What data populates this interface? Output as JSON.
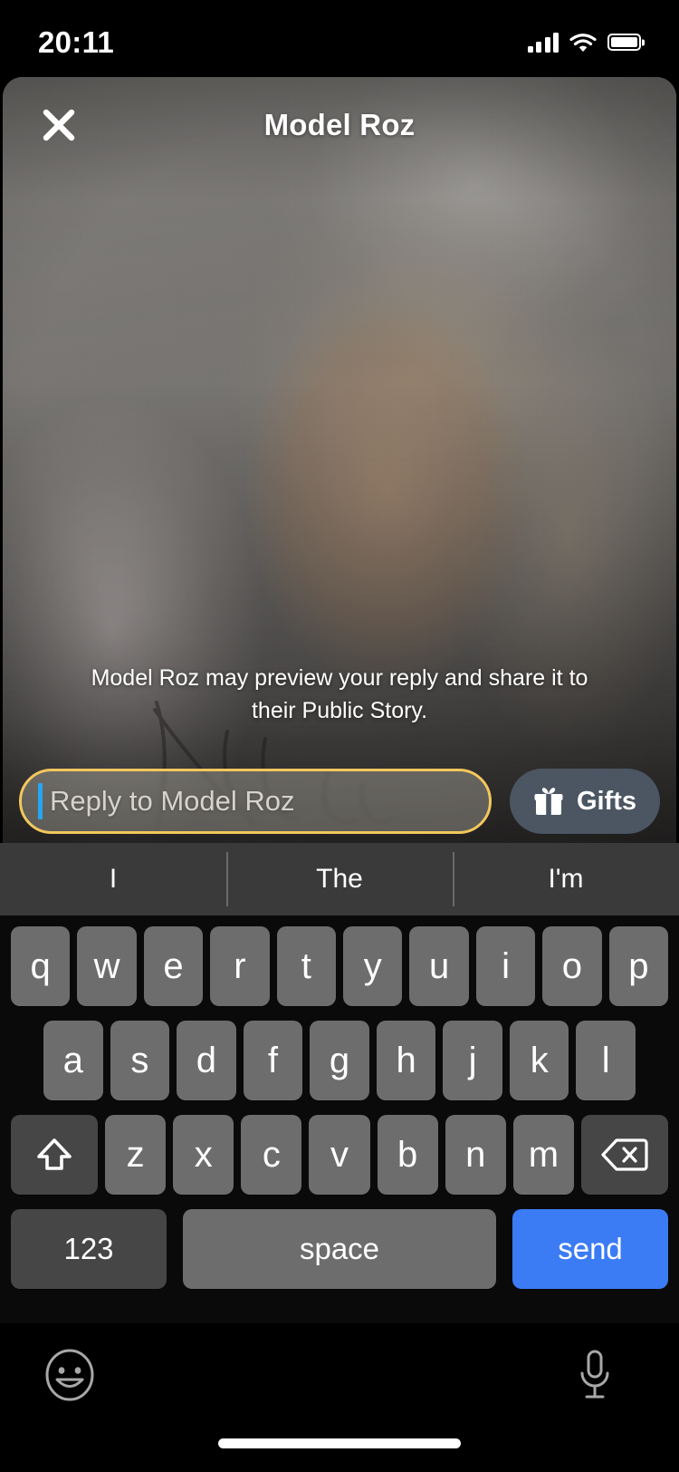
{
  "status_bar": {
    "time": "20:11",
    "signal_icon": "cellular-signal-icon",
    "signal_bars": 4,
    "wifi_icon": "wifi-icon",
    "battery_icon": "battery-icon",
    "battery_level": 100
  },
  "story": {
    "close_icon": "close-x-icon",
    "title": "Model Roz",
    "disclaimer": "Model Roz may preview your reply and share it to their Public Story."
  },
  "reply": {
    "placeholder": "Reply to Model Roz",
    "value": "",
    "caret_color": "#27a6f0",
    "border_color": "#f2c75c",
    "gifts_label": "Gifts",
    "gifts_icon": "gift-icon",
    "gifts_bg": "#4b5662"
  },
  "predictive": {
    "suggestions": [
      "I",
      "The",
      "I'm"
    ]
  },
  "keyboard": {
    "row1": [
      "q",
      "w",
      "e",
      "r",
      "t",
      "y",
      "u",
      "i",
      "o",
      "p"
    ],
    "row2": [
      "a",
      "s",
      "d",
      "f",
      "g",
      "h",
      "j",
      "k",
      "l"
    ],
    "row3_letters": [
      "z",
      "x",
      "c",
      "v",
      "b",
      "n",
      "m"
    ],
    "shift_icon": "shift-arrow-icon",
    "backspace_icon": "backspace-delete-icon",
    "numbers_label": "123",
    "space_label": "space",
    "send_label": "send",
    "send_color": "#3b7cf5",
    "key_color": "#6d6d6d",
    "modifier_color": "#464646"
  },
  "bottom_bar": {
    "emoji_icon": "emoji-smiley-icon",
    "mic_icon": "microphone-icon",
    "home_indicator": "home-indicator-bar"
  }
}
